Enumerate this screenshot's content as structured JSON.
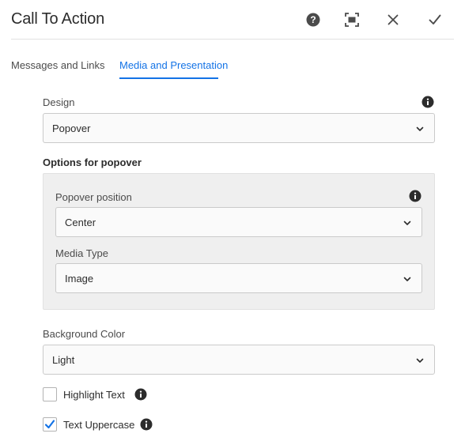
{
  "dialog": {
    "title": "Call To Action",
    "actions": {
      "help": "help-icon",
      "fullscreen": "fullscreen-icon",
      "close": "close-icon",
      "done": "checkmark-icon"
    }
  },
  "tabs": [
    {
      "label": "Messages and Links",
      "active": false
    },
    {
      "label": "Media and Presentation",
      "active": true
    }
  ],
  "design": {
    "label": "Design",
    "value": "Popover"
  },
  "popover_options": {
    "title": "Options for popover",
    "position": {
      "label": "Popover position",
      "value": "Center"
    },
    "media_type": {
      "label": "Media Type",
      "value": "Image"
    }
  },
  "background": {
    "label": "Background Color",
    "value": "Light"
  },
  "checkboxes": [
    {
      "label": "Highlight Text",
      "checked": false
    },
    {
      "label": "Text Uppercase",
      "checked": true
    }
  ],
  "colors": {
    "accent": "#1473e6",
    "text": "#2c2c2c",
    "group_bg": "#efefef"
  }
}
